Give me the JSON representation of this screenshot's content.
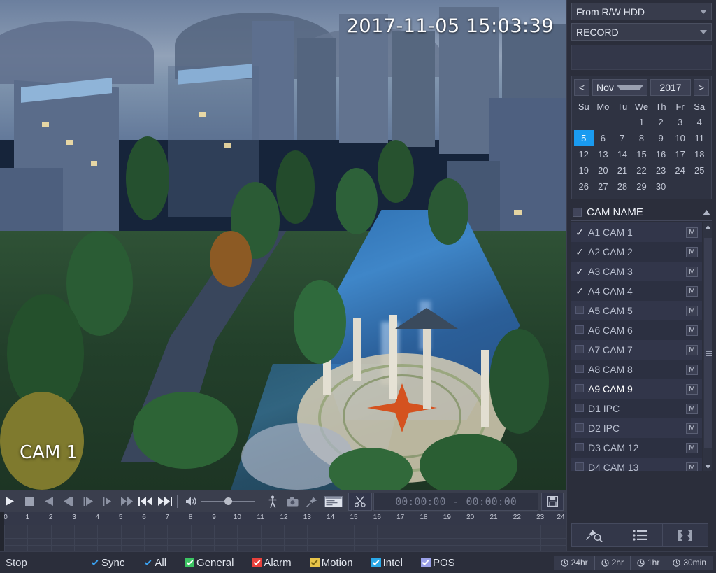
{
  "video": {
    "timestamp": "2017-11-05 15:03:39",
    "camera_label": "CAM 1"
  },
  "controls": {
    "play": "play-icon",
    "stop": "stop-icon",
    "reverse": "reverse-play-icon",
    "prev_frame": "previous-frame-icon",
    "next_frame": "next-frame-icon",
    "slow": "slow-play-icon",
    "fast": "fast-forward-icon",
    "prev_file": "previous-file-icon",
    "next_file": "next-file-icon",
    "volume": "volume-icon",
    "volume_level": 50,
    "smart_search": "smart-search-person-icon",
    "snapshot": "snapshot-camera-icon",
    "mark": "mark-pin-icon",
    "file_list": "file-list-icon",
    "clip": "scissors-clip-icon",
    "clip_start": "00:00:00",
    "clip_separator": "-",
    "clip_end": "00:00:00",
    "save": "save-floppy-icon"
  },
  "timeline": {
    "hours": [
      "0",
      "1",
      "2",
      "3",
      "4",
      "5",
      "6",
      "7",
      "8",
      "9",
      "10",
      "11",
      "12",
      "13",
      "14",
      "15",
      "16",
      "17",
      "18",
      "19",
      "20",
      "21",
      "22",
      "23",
      "24"
    ],
    "track_count": 4
  },
  "status": {
    "state": "Stop",
    "options": [
      {
        "label": "Sync",
        "checked": true,
        "color": "#2b6fc4",
        "fill": "transparent",
        "check_color": "#3aa0ef"
      },
      {
        "label": "All",
        "checked": true,
        "color": "#2b6fc4",
        "fill": "transparent",
        "check_color": "#3aa0ef"
      },
      {
        "label": "General",
        "checked": true,
        "color": "#3cc463",
        "fill": "#3cc463",
        "check_color": "#ffffff"
      },
      {
        "label": "Alarm",
        "checked": true,
        "color": "#e8413c",
        "fill": "#e8413c",
        "check_color": "#ffffff"
      },
      {
        "label": "Motion",
        "checked": true,
        "color": "#e8c44a",
        "fill": "#e8c44a",
        "check_color": "#7a6410"
      },
      {
        "label": "Intel",
        "checked": true,
        "color": "#2aa8e8",
        "fill": "#2aa8e8",
        "check_color": "#ffffff"
      },
      {
        "label": "POS",
        "checked": true,
        "color": "#9aa0e8",
        "fill": "#9aa0e8",
        "check_color": "#ffffff"
      }
    ],
    "zoom_buttons": [
      {
        "label": "24hr",
        "icon": "clock-icon"
      },
      {
        "label": "2hr",
        "icon": "clock-icon"
      },
      {
        "label": "1hr",
        "icon": "clock-icon"
      },
      {
        "label": "30min",
        "icon": "clock-icon"
      }
    ]
  },
  "sidebar": {
    "source_select": "From R/W HDD",
    "type_select": "RECORD",
    "calendar": {
      "prev_label": "<",
      "next_label": ">",
      "month": "Nov",
      "year": "2017",
      "weekdays": [
        "Su",
        "Mo",
        "Tu",
        "We",
        "Th",
        "Fr",
        "Sa"
      ],
      "leading_blanks": 3,
      "days": [
        1,
        2,
        3,
        4,
        5,
        6,
        7,
        8,
        9,
        10,
        11,
        12,
        13,
        14,
        15,
        16,
        17,
        18,
        19,
        20,
        21,
        22,
        23,
        24,
        25,
        26,
        27,
        28,
        29,
        30
      ],
      "selected_day": 5,
      "selected_color": "#1a9bf0"
    },
    "cam_list_header": "CAM NAME",
    "cameras": [
      {
        "id": "A1",
        "name": "A1 CAM 1",
        "checked": true,
        "badge": "M",
        "active": false
      },
      {
        "id": "A2",
        "name": "A2 CAM 2",
        "checked": true,
        "badge": "M",
        "active": false
      },
      {
        "id": "A3",
        "name": "A3 CAM 3",
        "checked": true,
        "badge": "M",
        "active": false
      },
      {
        "id": "A4",
        "name": "A4 CAM 4",
        "checked": true,
        "badge": "M",
        "active": false
      },
      {
        "id": "A5",
        "name": "A5 CAM 5",
        "checked": false,
        "badge": "M",
        "active": false
      },
      {
        "id": "A6",
        "name": "A6 CAM 6",
        "checked": false,
        "badge": "M",
        "active": false
      },
      {
        "id": "A7",
        "name": "A7 CAM 7",
        "checked": false,
        "badge": "M",
        "active": false
      },
      {
        "id": "A8",
        "name": "A8 CAM 8",
        "checked": false,
        "badge": "M",
        "active": false
      },
      {
        "id": "A9",
        "name": "A9 CAM 9",
        "checked": false,
        "badge": "M",
        "active": true
      },
      {
        "id": "D1",
        "name": "D1 IPC",
        "checked": false,
        "badge": "M",
        "active": false
      },
      {
        "id": "D2",
        "name": "D2 IPC",
        "checked": false,
        "badge": "M",
        "active": false
      },
      {
        "id": "D3",
        "name": "D3 CAM 12",
        "checked": false,
        "badge": "M",
        "active": false
      },
      {
        "id": "D4",
        "name": "D4 CAM 13",
        "checked": false,
        "badge": "M",
        "active": false
      }
    ],
    "bottom_buttons": [
      {
        "icon": "mark-search-icon"
      },
      {
        "icon": "file-list-icon"
      },
      {
        "icon": "fullscreen-icon"
      }
    ]
  }
}
